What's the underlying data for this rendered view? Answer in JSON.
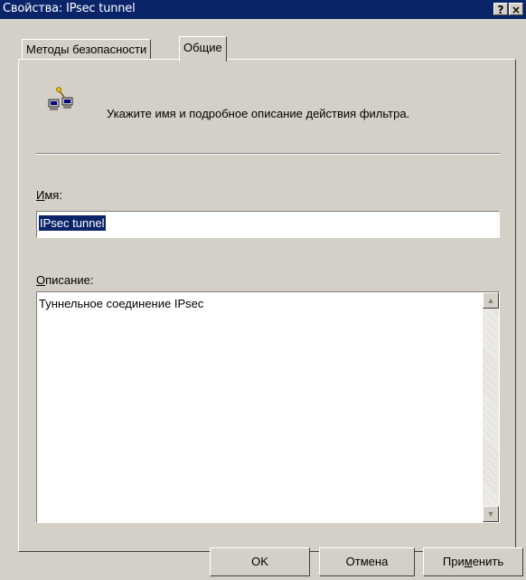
{
  "window": {
    "title": "Свойства: IPsec tunnel",
    "help_glyph": "?",
    "close_glyph": "×"
  },
  "tabs": [
    {
      "label": "Методы безопасности",
      "active": false
    },
    {
      "label": "Общие",
      "active": true
    }
  ],
  "general": {
    "icon": "network-filter-icon",
    "description": "Укажите имя и подробное описание действия фильтра.",
    "name_label_accel": "И",
    "name_label_rest": "мя:",
    "name_value": "IPsec tunnel",
    "desc_label_accel": "О",
    "desc_label_rest": "писание:",
    "desc_value": "Туннельное соединение IPsec",
    "scroll_up_glyph": "▲",
    "scroll_down_glyph": "▼"
  },
  "buttons": {
    "ok": "OK",
    "cancel": "Отмена",
    "apply_pre": "При",
    "apply_accel": "м",
    "apply_post": "енить"
  },
  "colors": {
    "titlebar": "#0a246a",
    "face": "#d4d0c8",
    "selection": "#0a246a"
  }
}
